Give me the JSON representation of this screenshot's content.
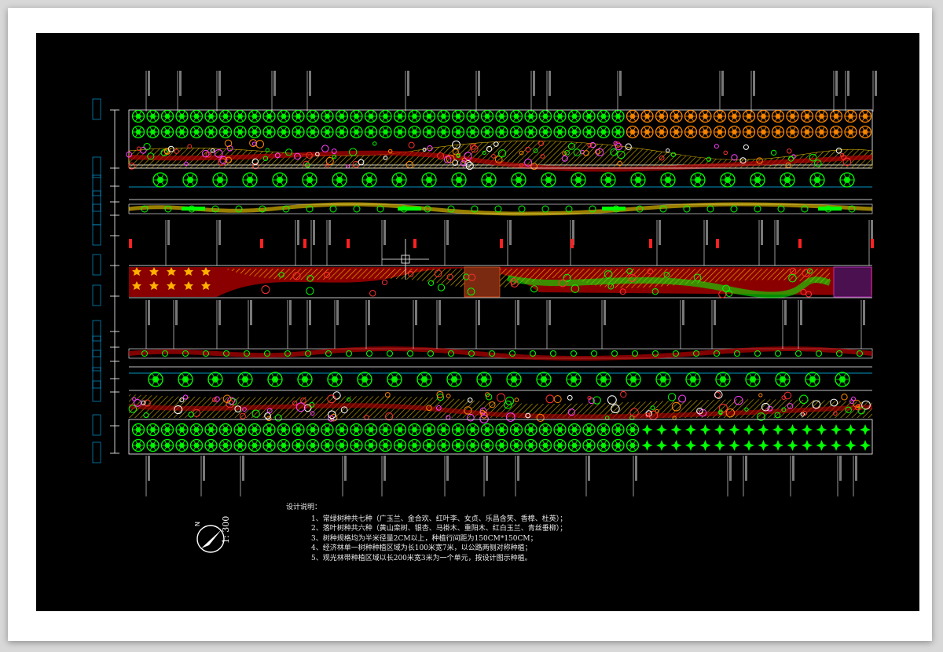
{
  "drawing": {
    "scale_label": "1: 300",
    "compass_label": "N",
    "notes": {
      "title": "设计说明：",
      "items": [
        "1、常绿树种共七种（广玉兰、金合欢、红叶李、女贞、乐昌含笑、香樟、杜英）；",
        "2、落叶树种共六种（黄山栾树、银杏、马褂木、重阳木、红白玉兰、青丝垂柳）；",
        "3、树种规格均为半米径量2CM以上，种植行间距为150CM*150CM；",
        "4、经济林单一树种种植区域为长100米宽7米，以公路两侧对称种植；",
        "5、观光林带种植区域以长200米宽3米为一个单元，按设计图示种植。"
      ]
    },
    "colors": {
      "background": "#000000",
      "tree_green": "#00ff00",
      "orange": "#ff8800",
      "red_band": "#b80000",
      "magenta": "#ff40ff",
      "yellow_hatch": "#ffd400",
      "cyan_line": "#00c8ff",
      "white_line": "#ffffff"
    }
  }
}
